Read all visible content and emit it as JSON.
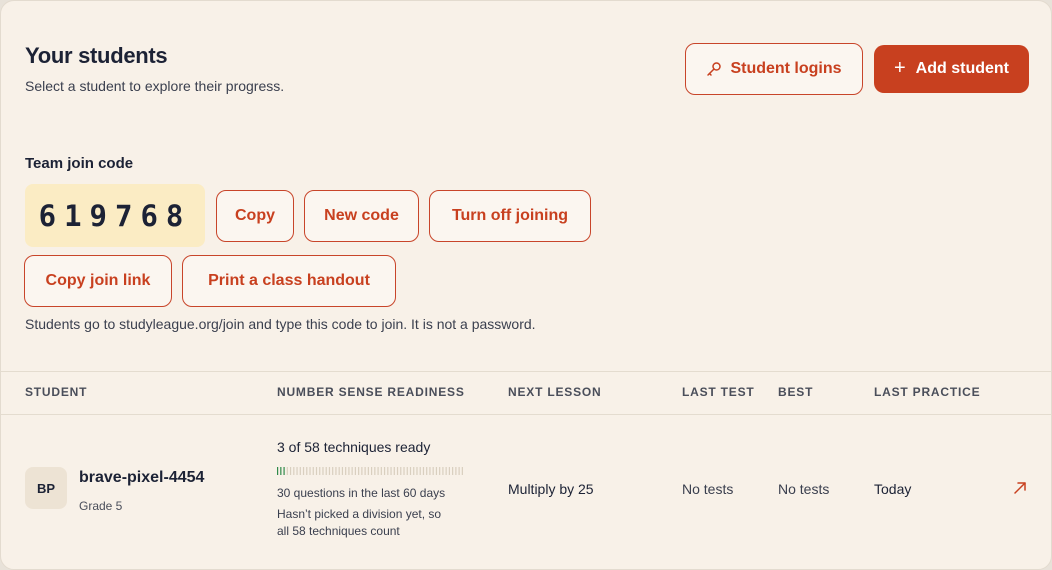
{
  "header": {
    "title": "Your students",
    "subtitle": "Select a student to explore their progress.",
    "student_logins_label": "Student logins",
    "add_student_label": "Add student",
    "add_icon": "plus-icon",
    "logins_icon": "key-icon"
  },
  "join": {
    "label": "Team join code",
    "code": "619768",
    "copy_label": "Copy",
    "new_code_label": "New code",
    "turn_off_label": "Turn off joining",
    "copy_link_label": "Copy join link",
    "print_label": "Print a class handout",
    "note": "Students go to studyleague.org/join and type this code to join. It is not a password."
  },
  "table": {
    "columns": [
      "STUDENT",
      "NUMBER SENSE READINESS",
      "NEXT LESSON",
      "LAST TEST",
      "BEST",
      "LAST PRACTICE"
    ],
    "rows": [
      {
        "initials": "BP",
        "name": "brave-pixel-4454",
        "grade": "Grade 5",
        "readiness": "3 of 58 techniques ready",
        "ready_count": 3,
        "total_count": 58,
        "questions": "30 questions in the last 60 days",
        "division_note_1": "Hasn’t picked a division yet, so",
        "division_note_2": "all 58 techniques count",
        "next_lesson": "Multiply by 25",
        "last_test": "No tests",
        "best": "No tests",
        "last_practice": "Today",
        "open_icon": "arrow-up-right-icon"
      }
    ]
  },
  "colors": {
    "accent": "#c8401f",
    "background": "#f8f1e8",
    "code_bg": "#fbecc4",
    "ready_tick": "#2f8a4a",
    "pending_tick": "#d9cfbf"
  }
}
